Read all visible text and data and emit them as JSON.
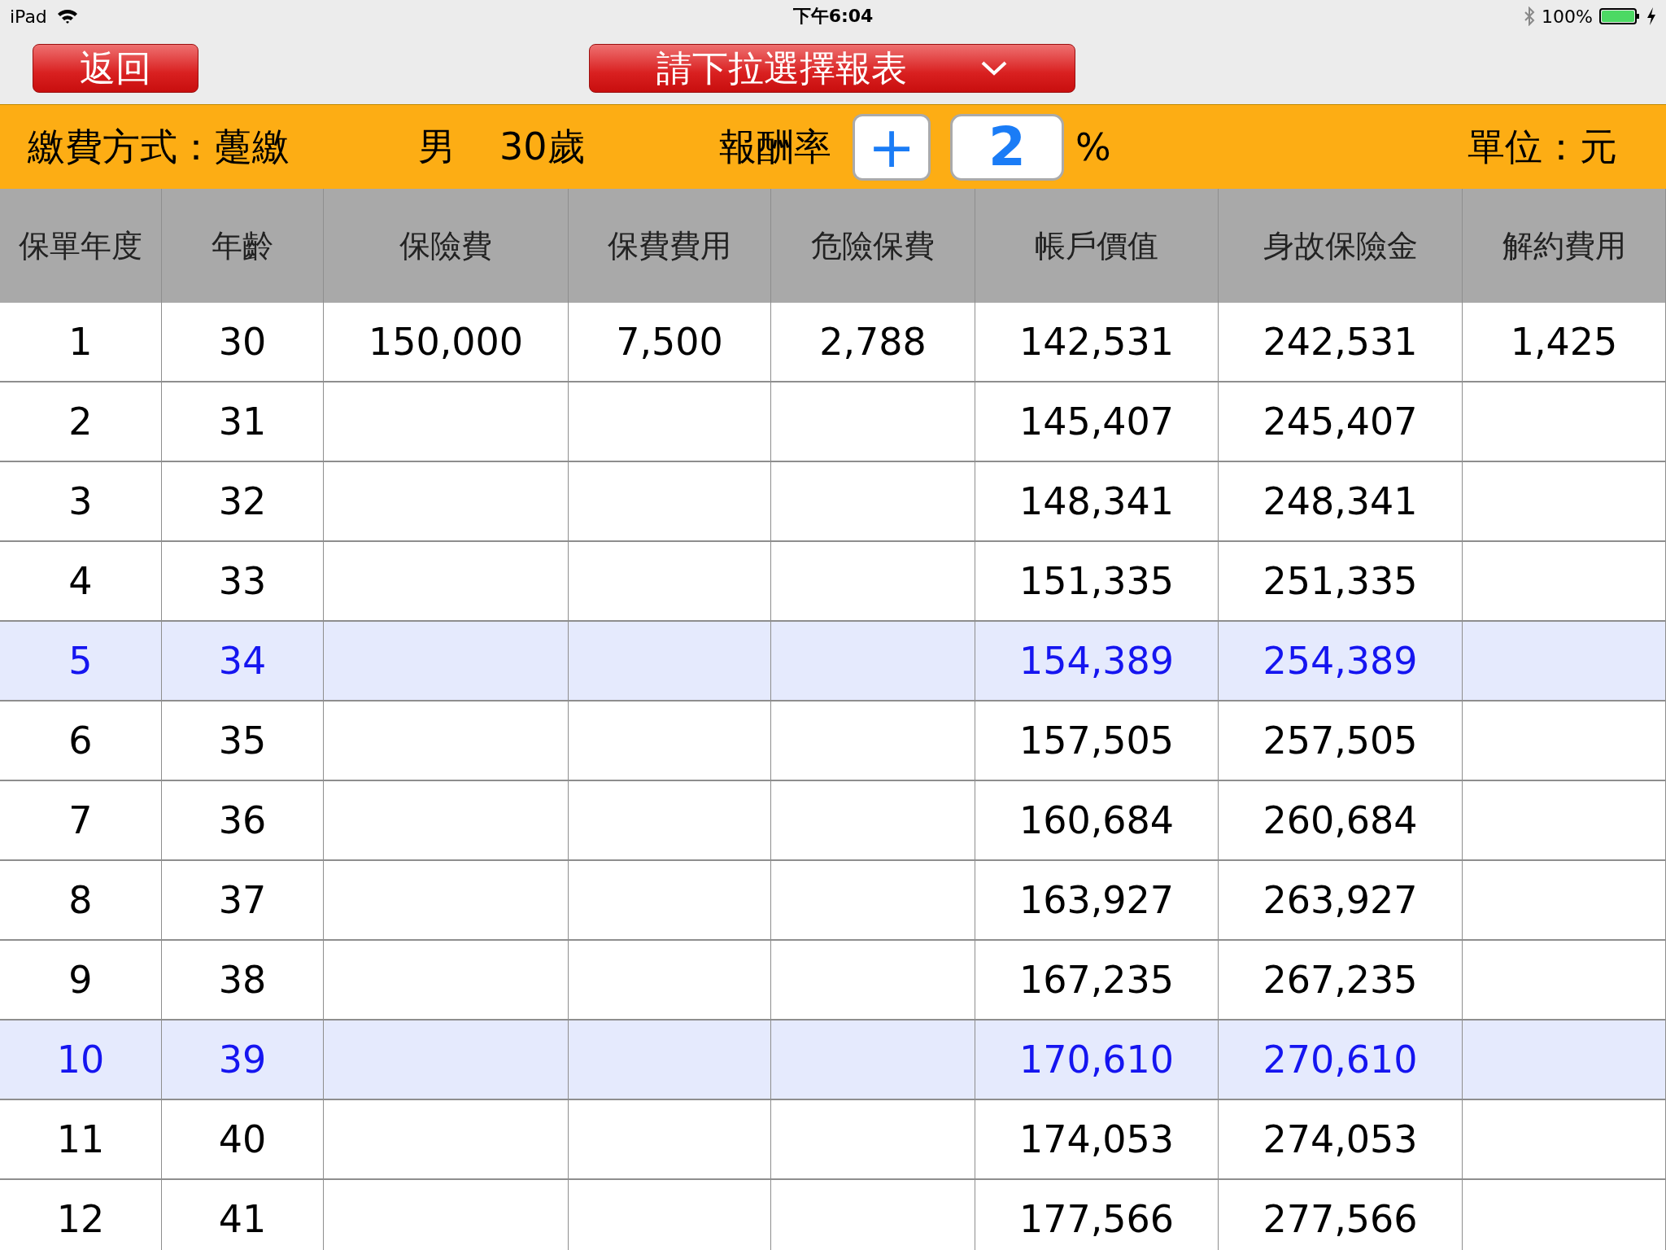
{
  "status_bar": {
    "device": "iPad",
    "time": "下午6:04",
    "battery": "100%"
  },
  "toolbar": {
    "back_button": "返回",
    "report_dropdown": "請下拉選擇報表"
  },
  "info_bar": {
    "payment_method": "繳費方式：躉繳",
    "gender": "男",
    "age": "30歲",
    "rate_label": "報酬率",
    "plus_button": "+",
    "rate_value": "2",
    "percent": "%",
    "unit": "單位：元"
  },
  "table": {
    "columns": [
      "保單年度",
      "年齡",
      "保險費",
      "保費費用",
      "危險保費",
      "帳戶價值",
      "身故保險金",
      "解約費用"
    ],
    "rows": [
      {
        "highlighted": false,
        "cells": [
          "1",
          "30",
          "150,000",
          "7,500",
          "2,788",
          "142,531",
          "242,531",
          "1,425"
        ]
      },
      {
        "highlighted": false,
        "cells": [
          "2",
          "31",
          null,
          null,
          null,
          "145,407",
          "245,407",
          null
        ]
      },
      {
        "highlighted": false,
        "cells": [
          "3",
          "32",
          null,
          null,
          null,
          "148,341",
          "248,341",
          null
        ]
      },
      {
        "highlighted": false,
        "cells": [
          "4",
          "33",
          null,
          null,
          null,
          "151,335",
          "251,335",
          null
        ]
      },
      {
        "highlighted": true,
        "cells": [
          "5",
          "34",
          null,
          null,
          null,
          "154,389",
          "254,389",
          null
        ]
      },
      {
        "highlighted": false,
        "cells": [
          "6",
          "35",
          null,
          null,
          null,
          "157,505",
          "257,505",
          null
        ]
      },
      {
        "highlighted": false,
        "cells": [
          "7",
          "36",
          null,
          null,
          null,
          "160,684",
          "260,684",
          null
        ]
      },
      {
        "highlighted": false,
        "cells": [
          "8",
          "37",
          null,
          null,
          null,
          "163,927",
          "263,927",
          null
        ]
      },
      {
        "highlighted": false,
        "cells": [
          "9",
          "38",
          null,
          null,
          null,
          "167,235",
          "267,235",
          null
        ]
      },
      {
        "highlighted": true,
        "cells": [
          "10",
          "39",
          null,
          null,
          null,
          "170,610",
          "270,610",
          null
        ]
      },
      {
        "highlighted": false,
        "cells": [
          "11",
          "40",
          null,
          null,
          null,
          "174,053",
          "274,053",
          null
        ]
      },
      {
        "highlighted": false,
        "cells": [
          "12",
          "41",
          null,
          null,
          null,
          "177,566",
          "277,566",
          null
        ]
      }
    ]
  }
}
